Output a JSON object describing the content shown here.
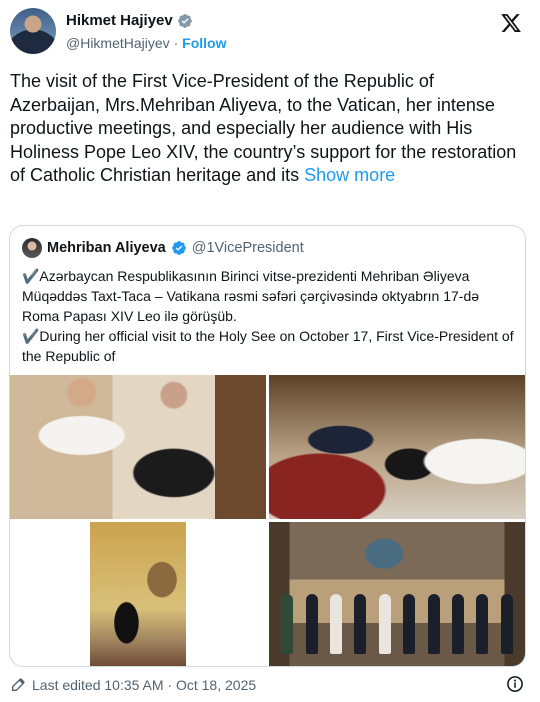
{
  "author": {
    "name": "Hikmet Hajiyev",
    "handle": "@HikmetHajiyev",
    "separator": "·",
    "follow_label": "Follow"
  },
  "tweet": {
    "text": "The visit of the First Vice-President of the Republic of Azerbaijan, Mrs.Mehriban Aliyeva, to the Vatican, her intense productive meetings, and especially her audience with His Holiness Pope Leo XIV, the country’s support for the restoration of Catholic Christian heritage and its ",
    "show_more_label": "Show more"
  },
  "quote": {
    "name": "Mehriban Aliyeva",
    "handle": "@1VicePresident",
    "line1": "✔️Azərbaycan Respublikasının Birinci vitse-prezidenti Mehriban Əliyeva Müqəddəs Taxt-Taca – Vatikana rəsmi səfəri çərçivəsində oktyabrın 17-də Roma Papası XIV Leo ilə görüşüb.",
    "line2": "✔️During her official visit to the Holy See on October 17, First Vice-President of the Republic of"
  },
  "footer": {
    "edited_text": "Last edited 10:35 AM · Oct 18, 2025"
  },
  "icons": {
    "verified": "verified-badge-icon",
    "x_logo": "x-logo-icon",
    "edit": "pencil-edit-icon",
    "info": "info-icon"
  },
  "colors": {
    "accent": "#1d9bf0",
    "text": "#0f1419",
    "secondary": "#536471",
    "border": "#cfd9de"
  }
}
